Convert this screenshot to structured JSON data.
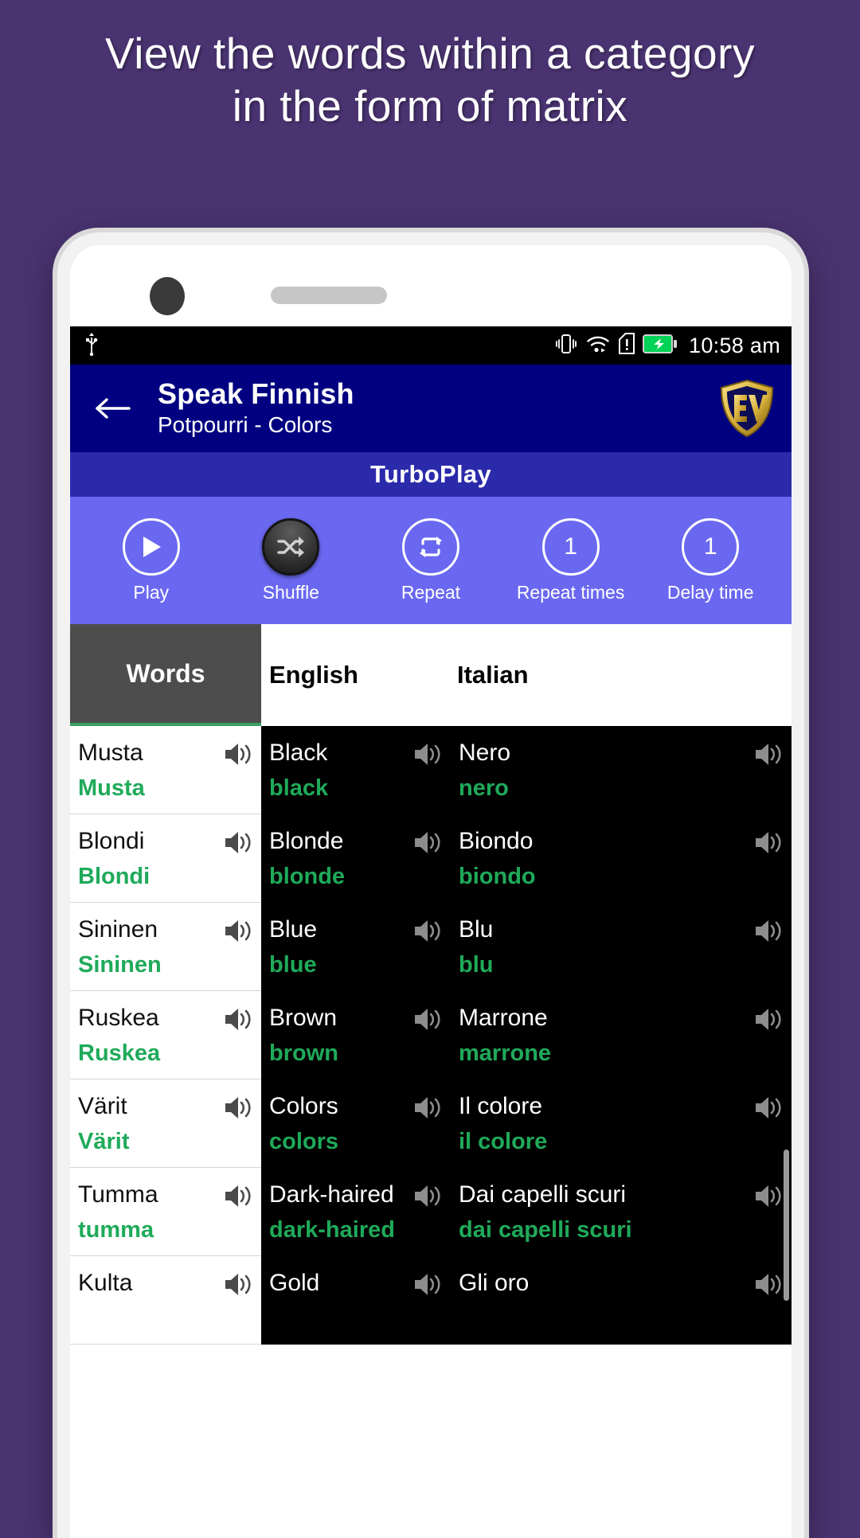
{
  "promo": {
    "heading": "View the words within a category in the form of matrix"
  },
  "statusbar": {
    "usb_icon": "usb-icon",
    "vibrate_icon": "vibrate-icon",
    "wifi_icon": "wifi-icon",
    "sim_alert_icon": "sim-card-alert-icon",
    "battery_icon": "battery-charging-icon",
    "time": "10:58 am"
  },
  "appbar": {
    "back_icon": "back-arrow-icon",
    "title": "Speak Finnish",
    "subtitle": "Potpourri - Colors",
    "logo_text": "EV",
    "logo_icon": "ev-shield-logo"
  },
  "turbobar": {
    "label": "TurboPlay"
  },
  "controls": [
    {
      "label": "Play",
      "icon": "play-icon",
      "value": "",
      "active": false
    },
    {
      "label": "Shuffle",
      "icon": "shuffle-icon",
      "value": "",
      "active": true
    },
    {
      "label": "Repeat",
      "icon": "repeat-icon",
      "value": "",
      "active": false
    },
    {
      "label": "Repeat times",
      "icon": "number",
      "value": "1",
      "active": false
    },
    {
      "label": "Delay time",
      "icon": "number",
      "value": "1",
      "active": false
    }
  ],
  "table": {
    "headers": {
      "words": "Words",
      "english": "English",
      "italian": "Italian"
    },
    "rows": [
      {
        "word": "Musta",
        "word_tr": "Musta",
        "english": "Black",
        "english_tr": "black",
        "italian": "Nero",
        "italian_tr": "nero"
      },
      {
        "word": "Blondi",
        "word_tr": "Blondi",
        "english": "Blonde",
        "english_tr": "blonde",
        "italian": "Biondo",
        "italian_tr": "biondo"
      },
      {
        "word": "Sininen",
        "word_tr": "Sininen",
        "english": "Blue",
        "english_tr": "blue",
        "italian": "Blu",
        "italian_tr": "blu"
      },
      {
        "word": "Ruskea",
        "word_tr": "Ruskea",
        "english": "Brown",
        "english_tr": "brown",
        "italian": "Marrone",
        "italian_tr": "marrone"
      },
      {
        "word": "Värit",
        "word_tr": "Värit",
        "english": "Colors",
        "english_tr": "colors",
        "italian": "Il colore",
        "italian_tr": "il colore"
      },
      {
        "word": "Tumma",
        "word_tr": "tumma",
        "english": "Dark-haired",
        "english_tr": "dark-haired",
        "italian": "Dai capelli scuri",
        "italian_tr": "dai capelli scuri"
      },
      {
        "word": "Kulta",
        "word_tr": "",
        "english": "Gold",
        "english_tr": "",
        "italian": "Gli oro",
        "italian_tr": ""
      }
    ],
    "speaker_icon": "speaker-icon"
  },
  "colors": {
    "promo_background": "#4a3371",
    "appbar": "#000080",
    "turbobar": "#2a2aab",
    "controls": "#6a68f0",
    "header_words": "#4d4d4d",
    "transliteration": "#1faa5a",
    "logo_gold": "#d4af37"
  }
}
